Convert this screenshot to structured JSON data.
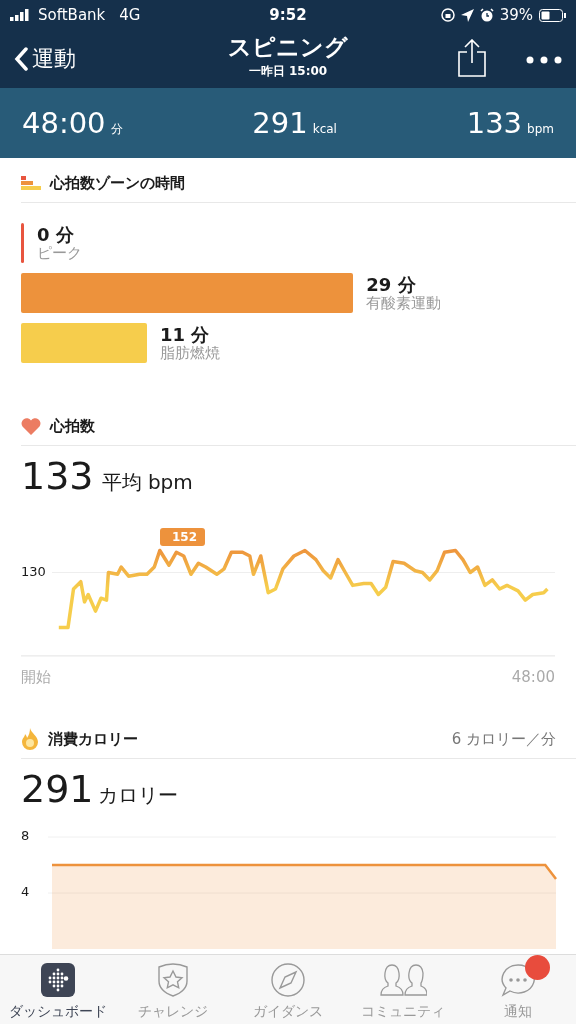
{
  "status_bar": {
    "carrier": "SoftBank",
    "network": "4G",
    "time": "9:52",
    "battery": "39%"
  },
  "nav": {
    "back": "運動",
    "title": "スピニング",
    "subtitle": "一昨日 15:00"
  },
  "summary": [
    {
      "value": "48:00",
      "unit": "分"
    },
    {
      "value": "291",
      "unit": "kcal"
    },
    {
      "value": "133",
      "unit": "bpm"
    }
  ],
  "zones": {
    "title": "心拍数ゾーンの時間",
    "items": [
      {
        "time": "0 分",
        "name": "ピーク",
        "color": "#e8553f"
      },
      {
        "time": "29 分",
        "name": "有酸素運動",
        "color": "#ed923c"
      },
      {
        "time": "11 分",
        "name": "脂肪燃焼",
        "color": "#f6cd4c"
      }
    ]
  },
  "heart_rate": {
    "title": "心拍数",
    "value": "133",
    "unit": "平均 bpm",
    "peak_label": "152",
    "tick_label": "130",
    "start_label": "開始",
    "end_label": "48:00"
  },
  "calories": {
    "title": "消費カロリー",
    "rate": "6 カロリー／分",
    "value": "291",
    "unit": "カロリー",
    "chart_data": {
      "type": "area",
      "ylim": [
        0,
        8
      ],
      "yticks": [
        4,
        8
      ],
      "series": [
        {
          "color": "#ed923c",
          "values": [
            6,
            6,
            6,
            6,
            6,
            6,
            6,
            6,
            6,
            6,
            6,
            6,
            6,
            6,
            6,
            6,
            6,
            6,
            6,
            6,
            6,
            6,
            6,
            6,
            6,
            6,
            6,
            6,
            6,
            6,
            6,
            6,
            6,
            6,
            6,
            6,
            6,
            6,
            6,
            6,
            6,
            6,
            6,
            6,
            6,
            6,
            6,
            5
          ]
        }
      ]
    }
  },
  "tab_bar": [
    {
      "label": "ダッシュボード",
      "kind": "dashboard",
      "selected": true,
      "badge": false
    },
    {
      "label": "チャレンジ",
      "kind": "challenge",
      "selected": false,
      "badge": false
    },
    {
      "label": "ガイダンス",
      "kind": "guidance",
      "selected": false,
      "badge": false
    },
    {
      "label": "コミュニティ",
      "kind": "community",
      "selected": false,
      "badge": false
    },
    {
      "label": "通知",
      "kind": "notifications",
      "selected": false,
      "badge": true
    }
  ]
}
